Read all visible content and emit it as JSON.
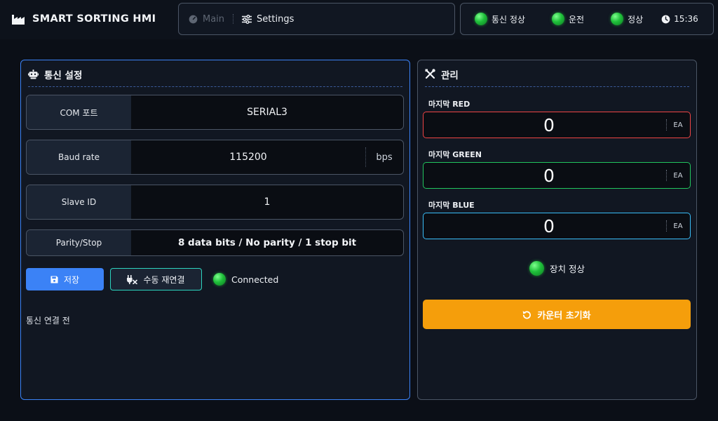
{
  "header": {
    "app_title": "SMART SORTING HMI",
    "nav": {
      "main": "Main",
      "settings": "Settings"
    },
    "status": {
      "comm": "통신 정상",
      "run": "운전",
      "normal": "정상",
      "time": "15:36"
    }
  },
  "comm_panel": {
    "title": "통신 설정",
    "rows": {
      "com": {
        "label": "COM 포트",
        "value": "SERIAL3"
      },
      "baud": {
        "label": "Baud rate",
        "value": "115200",
        "unit": "bps"
      },
      "slave": {
        "label": "Slave ID",
        "value": "1"
      },
      "parity": {
        "label": "Parity/Stop",
        "value": "8 data bits / No parity / 1 stop bit"
      }
    },
    "save_label": "저장",
    "reconnect_label": "수동 재연결",
    "connection_status": "Connected",
    "message": "통신 연결 전"
  },
  "manage_panel": {
    "title": "관리",
    "counters": {
      "red": {
        "label": "마지막 RED",
        "value": "0",
        "unit": "EA"
      },
      "green": {
        "label": "마지막 GREEN",
        "value": "0",
        "unit": "EA"
      },
      "blue": {
        "label": "마지막 BLUE",
        "value": "0",
        "unit": "EA"
      }
    },
    "device_status": "장치 정상",
    "reset_label": "카운터 초기화"
  },
  "colors": {
    "accent_blue": "#3b82f6",
    "teal": "#2dd4bf",
    "warning_orange": "#f59e0b",
    "red": "#ef4444",
    "green": "#22c55e",
    "sky": "#38bdf8",
    "led_green": "#1fbf3a"
  },
  "icons": {
    "brand": "factory-icon",
    "main": "gauge-icon",
    "settings": "sliders-icon",
    "clock": "clock-icon",
    "comm_panel": "robot-icon",
    "manage_panel": "tools-icon",
    "save": "floppy-disk-icon",
    "reconnect": "plug-icon",
    "reset": "rotate-left-icon"
  }
}
